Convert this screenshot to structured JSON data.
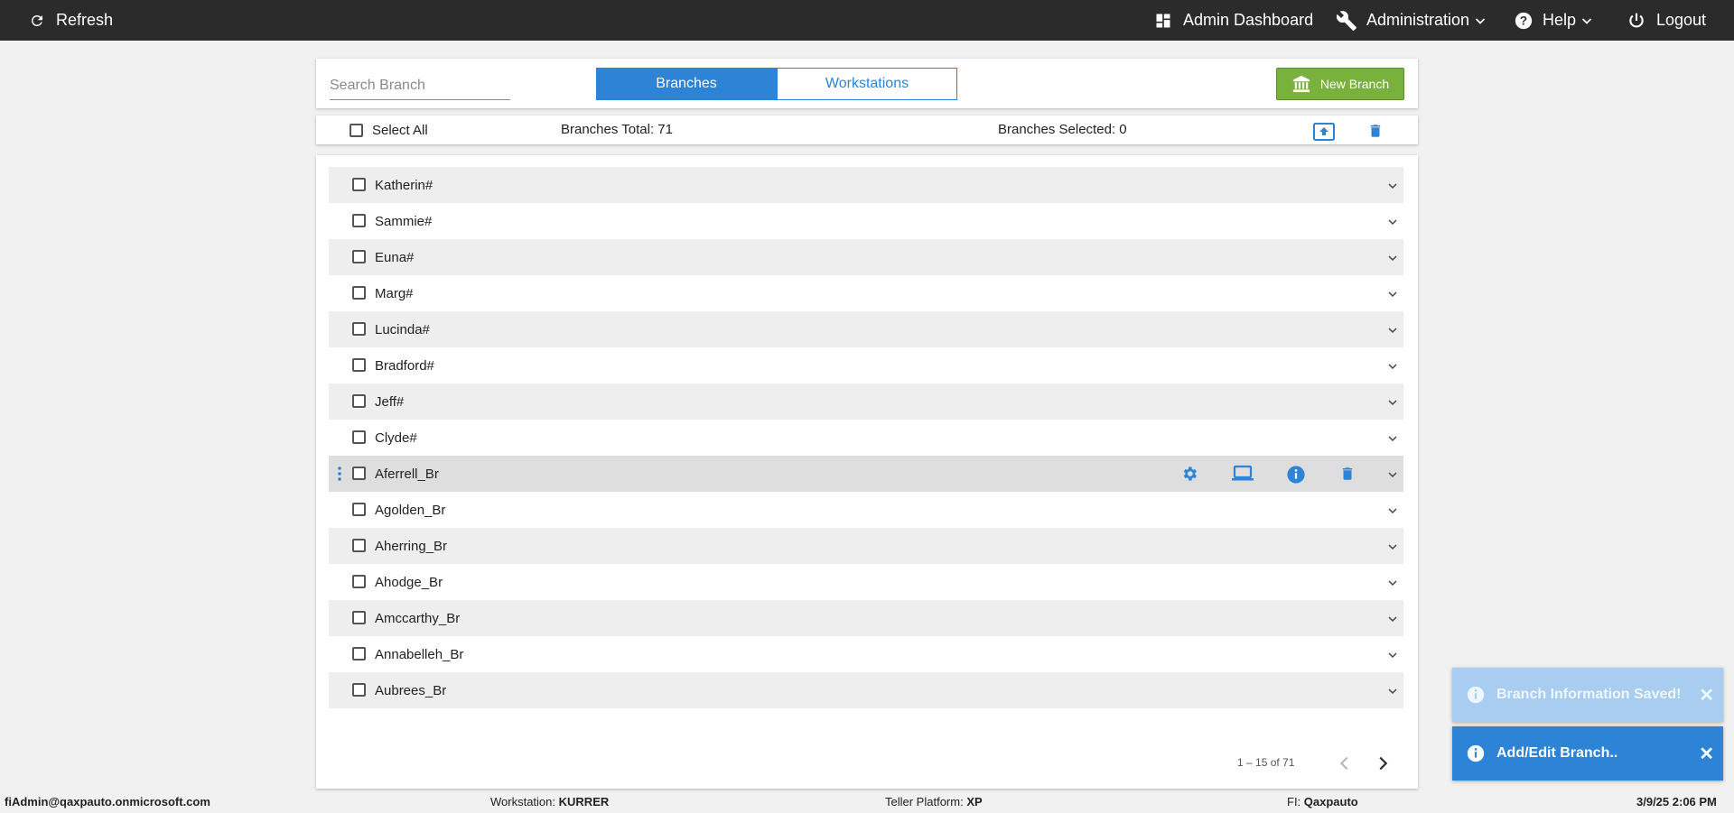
{
  "topbar": {
    "refresh_label": "Refresh",
    "admin_dashboard_label": "Admin Dashboard",
    "administration_label": "Administration",
    "help_label": "Help",
    "logout_label": "Logout"
  },
  "header": {
    "search_placeholder": "Search Branch",
    "tabs": [
      {
        "label": "Branches",
        "active": true
      },
      {
        "label": "Workstations",
        "active": false
      }
    ],
    "new_branch_label": "New Branch"
  },
  "toolbar": {
    "select_all_label": "Select All",
    "branches_total": "Branches Total: 71",
    "branches_selected": "Branches Selected: 0"
  },
  "branches": [
    {
      "name": "Katherin#"
    },
    {
      "name": "Sammie#"
    },
    {
      "name": "Euna#"
    },
    {
      "name": "Marg#"
    },
    {
      "name": "Lucinda#"
    },
    {
      "name": "Bradford#"
    },
    {
      "name": "Jeff#"
    },
    {
      "name": "Clyde#"
    },
    {
      "name": "Aferrell_Br",
      "hovered": true
    },
    {
      "name": "Agolden_Br"
    },
    {
      "name": "Aherring_Br"
    },
    {
      "name": "Ahodge_Br"
    },
    {
      "name": "Amccarthy_Br"
    },
    {
      "name": "Annabelleh_Br"
    },
    {
      "name": "Aubrees_Br"
    }
  ],
  "pagination": {
    "range_label": "1 – 15 of 71"
  },
  "footer": {
    "user": "fiAdmin@qaxpauto.onmicrosoft.com",
    "workstation_label": "Workstation:",
    "workstation_value": "KURRER",
    "teller_platform_label": "Teller Platform:",
    "teller_platform_value": "XP",
    "fi_label": "FI:",
    "fi_value": "Qaxpauto",
    "datetime": "3/9/25 2:06 PM"
  },
  "toasts": [
    {
      "message": "Branch Information Saved!",
      "faded": true
    },
    {
      "message": "Add/Edit Branch..",
      "faded": false
    }
  ],
  "colors": {
    "accent": "#2d83d6",
    "new_branch": "#78b13b",
    "topbar": "#2b2b2b"
  },
  "icons": [
    "refresh-icon",
    "dashboard-icon",
    "wrench-icon",
    "help-icon",
    "power-icon",
    "bank-icon",
    "upload-icon",
    "trash-icon",
    "gear-icon",
    "laptop-icon",
    "info-icon",
    "chevron-down-icon"
  ]
}
